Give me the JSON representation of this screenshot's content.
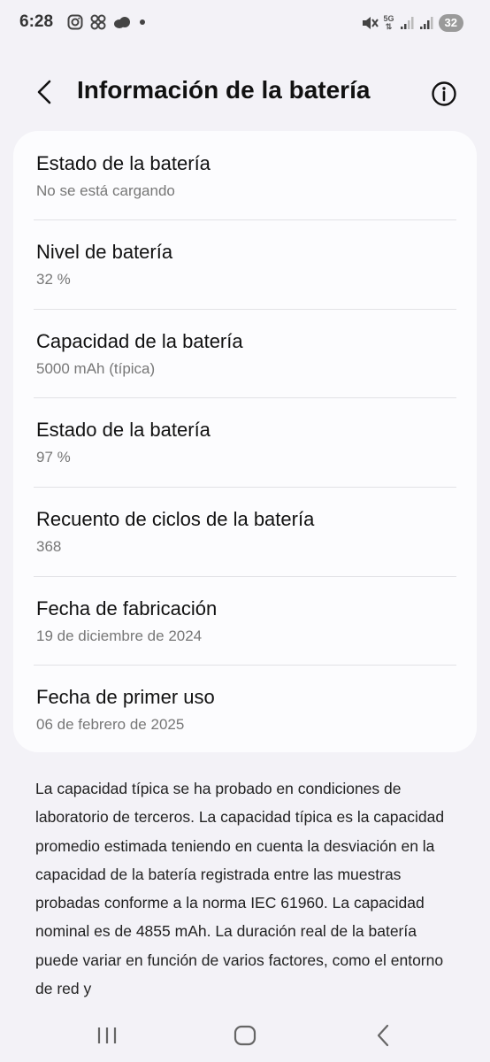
{
  "status_bar": {
    "time": "6:28",
    "battery_level": "32",
    "network": "5G",
    "icons": [
      "instagram-icon",
      "pinwheel-icon",
      "cloud-icon",
      "dot-icon",
      "mute-icon",
      "5g-icon",
      "signal-icon",
      "signal-icon"
    ]
  },
  "header": {
    "title": "Información de la batería"
  },
  "items": [
    {
      "label": "Estado de la batería",
      "value": "No se está cargando"
    },
    {
      "label": "Nivel de batería",
      "value": "32 %"
    },
    {
      "label": "Capacidad de la batería",
      "value": "5000 mAh (típica)"
    },
    {
      "label": "Estado de la batería",
      "value": "97 %"
    },
    {
      "label": "Recuento de ciclos de la batería",
      "value": "368"
    },
    {
      "label": "Fecha de fabricación",
      "value": "19 de diciembre de 2024"
    },
    {
      "label": "Fecha de primer uso",
      "value": "06 de febrero de 2025"
    }
  ],
  "note": "La capacidad típica se ha probado en condiciones de laboratorio de terceros. La capacidad típica es la capacidad promedio estimada teniendo en cuenta la desviación en la capacidad de la batería registrada entre las muestras probadas conforme a la norma IEC 61960. La capacidad nominal es de 4855 mAh. La duración real de la batería puede variar en función de varios factores, como el entorno de red y",
  "colors": {
    "background": "#f3f2f7",
    "card": "#fcfcfe",
    "secondary_text": "#777777"
  }
}
